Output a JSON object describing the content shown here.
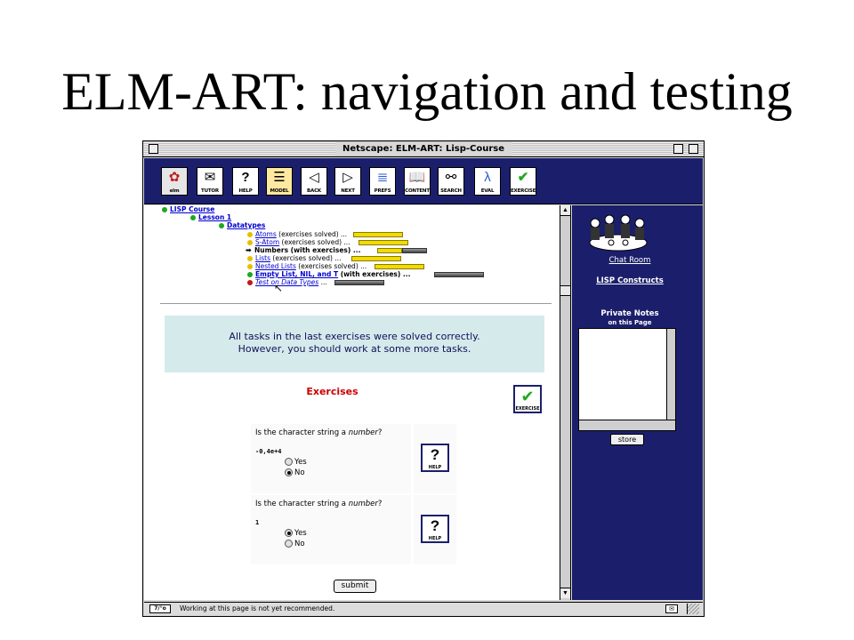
{
  "slide": {
    "title": "ELM-ART: navigation and testing"
  },
  "window": {
    "title": "Netscape: ELM-ART: Lisp-Course"
  },
  "toolbar": {
    "items": [
      {
        "label": "elm",
        "icon": "elm-logo-icon"
      },
      {
        "label": "TUTOR",
        "icon": "envelope-icon"
      },
      {
        "label": "HELP",
        "icon": "question-icon"
      },
      {
        "label": "MODEL",
        "icon": "list-icon"
      },
      {
        "label": "BACK",
        "icon": "arrow-left-icon"
      },
      {
        "label": "NEXT",
        "icon": "arrow-right-icon"
      },
      {
        "label": "PREFS",
        "icon": "preferences-icon"
      },
      {
        "label": "CONTENT",
        "icon": "book-icon"
      },
      {
        "label": "SEARCH",
        "icon": "binoculars-icon"
      },
      {
        "label": "EVAL",
        "icon": "lambda-icon"
      },
      {
        "label": "EXERCISE",
        "icon": "checkmark-icon"
      }
    ]
  },
  "tree": {
    "course": "LISP Course",
    "lesson": "Lesson 1",
    "section": "Datatypes",
    "items": [
      {
        "link": "Atoms",
        "note": "(exercises solved) ...",
        "status": "yellow",
        "bar": "yellow",
        "fill": 1.0
      },
      {
        "link": "S-Atom",
        "note": "(exercises solved) ...",
        "status": "yellow",
        "bar": "yellow",
        "fill": 1.0
      },
      {
        "link": "Numbers (with exercises)",
        "note": "...",
        "status": "current",
        "bar": "mixed",
        "fill": 0.5
      },
      {
        "link": "Lists",
        "note": "(exercises solved) ...",
        "status": "yellow",
        "bar": "yellow",
        "fill": 1.0
      },
      {
        "link": "Nested Lists",
        "note": "(exercises solved) ...",
        "status": "yellow",
        "bar": "yellow",
        "fill": 1.0
      },
      {
        "link": "Empty List, NIL, and T",
        "note": "(with exercises) ...",
        "status": "green",
        "bar": "gray",
        "fill": 0.0
      },
      {
        "link": "Test on Data Types",
        "note": "...",
        "status": "red",
        "bar": "gray",
        "fill": 0.0
      }
    ]
  },
  "message": {
    "line1": "All tasks in the last exercises were solved correctly.",
    "line2": "However, you should work at some more tasks."
  },
  "exercises": {
    "title": "Exercises",
    "button_label": "EXERCISE",
    "help_label": "HELP",
    "questions": [
      {
        "prefix": "Is the character string a ",
        "emph": "number",
        "suffix": "?",
        "value": "-0,4e+4",
        "options": [
          "Yes",
          "No"
        ],
        "selected": "No"
      },
      {
        "prefix": "Is the character string a ",
        "emph": "number",
        "suffix": "?",
        "value": "1",
        "options": [
          "Yes",
          "No"
        ],
        "selected": "Yes"
      }
    ],
    "submit": "submit"
  },
  "sidebar": {
    "chat": "Chat Room",
    "constructs": "LISP Constructs",
    "notes_title": "Private Notes",
    "notes_sub": "on this Page",
    "store": "store"
  },
  "status": {
    "icon_text": "7/°o",
    "text": "Working at this page is not yet recommended."
  },
  "colors": {
    "navy": "#1b1f6b",
    "message_bg": "#d5eaea",
    "exercises_red": "#cc0000",
    "link_blue": "#0000cc"
  }
}
